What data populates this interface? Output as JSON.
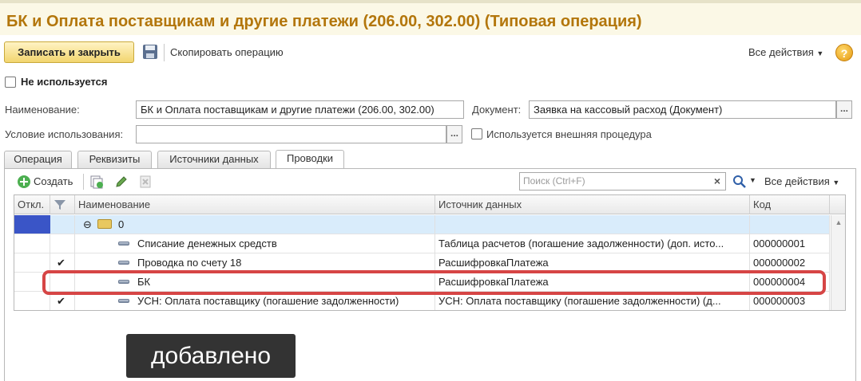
{
  "window": {
    "title": "БК и Оплата поставщикам и другие платежи (206.00, 302.00) (Типовая операция)"
  },
  "toolbar": {
    "save_close_label": "Записать и закрыть",
    "copy_label": "Скопировать операцию",
    "all_actions_label": "Все действия",
    "help_label": "?"
  },
  "form": {
    "not_used_label": "Не используется",
    "name_label": "Наименование:",
    "name_value": "БК и Оплата поставщикам и другие платежи (206.00, 302.00)",
    "document_label": "Документ:",
    "document_value": "Заявка на кассовый расход (Документ)",
    "condition_label": "Условие использования:",
    "condition_value": "",
    "external_proc_label": "Используется внешняя процедура",
    "dots": "..."
  },
  "tabs": [
    {
      "label": "Операция"
    },
    {
      "label": "Реквизиты"
    },
    {
      "label": "Источники данных"
    },
    {
      "label": "Проводки"
    }
  ],
  "grid_toolbar": {
    "create_label": "Создать",
    "search_placeholder": "Поиск (Ctrl+F)",
    "search_clear": "×",
    "all_actions_label": "Все действия"
  },
  "grid": {
    "columns": [
      "Откл.",
      "",
      "Наименование",
      "Источник данных",
      "Код"
    ],
    "group_row": {
      "name": "0"
    },
    "rows": [
      {
        "checked": "",
        "name": "Списание денежных средств",
        "source": "Таблица расчетов (погашение задолженности) (доп. исто...",
        "code": "000000001"
      },
      {
        "checked": "✔",
        "name": "Проводка по счету 18",
        "source": "РасшифровкаПлатежа",
        "code": "000000002"
      },
      {
        "checked": "",
        "name": "БК",
        "source": "РасшифровкаПлатежа",
        "code": "000000004"
      },
      {
        "checked": "✔",
        "name": "УСН: Оплата поставщику (погашение задолженности)",
        "source": "УСН: Оплата поставщику (погашение задолженности)  (д...",
        "code": "000000003"
      }
    ]
  },
  "annotation": {
    "caption": "добавлено",
    "highlight_color": "#d64545"
  },
  "colors": {
    "title": "#b3760b",
    "accent_button": "#f2d56f",
    "selection": "#3a55c7"
  }
}
